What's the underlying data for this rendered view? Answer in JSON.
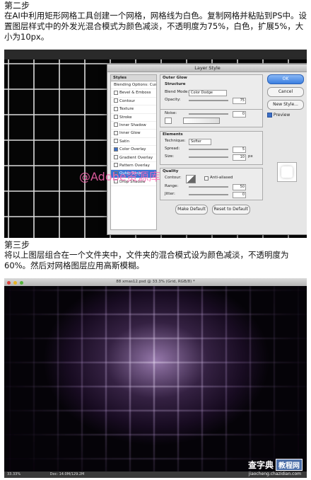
{
  "step2": {
    "title": "第二步",
    "text": "在AI中利用矩形网格工具创建一个网格，网格线为白色。复制网格并粘贴到PS中。设置图层样式中的外发光混合模式为颜色减淡，不透明度为75%，白色，扩展5%，大小为10px。"
  },
  "step3": {
    "title": "第三步",
    "text": "将以上图层组合在一个文件夹中，文件夹的混合模式设为颜色减淡，不透明度为60%。然后对网格图层应用高斯模糊。"
  },
  "dialog": {
    "title": "Layer Style",
    "styles_header": "Styles",
    "styles": [
      {
        "label": "Blending Options: Custom",
        "checked": false,
        "selected": false
      },
      {
        "label": "Bevel & Emboss",
        "checked": false,
        "selected": false
      },
      {
        "label": "Contour",
        "checked": false,
        "selected": false
      },
      {
        "label": "Texture",
        "checked": false,
        "selected": false
      },
      {
        "label": "Stroke",
        "checked": false,
        "selected": false
      },
      {
        "label": "Inner Shadow",
        "checked": false,
        "selected": false
      },
      {
        "label": "Inner Glow",
        "checked": false,
        "selected": false
      },
      {
        "label": "Satin",
        "checked": false,
        "selected": false
      },
      {
        "label": "Color Overlay",
        "checked": true,
        "selected": false
      },
      {
        "label": "Gradient Overlay",
        "checked": false,
        "selected": false
      },
      {
        "label": "Pattern Overlay",
        "checked": false,
        "selected": false
      },
      {
        "label": "Outer Glow",
        "checked": true,
        "selected": true
      },
      {
        "label": "Drop Shadow",
        "checked": false,
        "selected": false
      }
    ],
    "outer_glow": {
      "section": "Outer Glow",
      "structure": "Structure",
      "blend_mode_label": "Blend Mode:",
      "blend_mode_value": "Color Dodge",
      "opacity_label": "Opacity:",
      "opacity_value": "75",
      "noise_label": "Noise:",
      "noise_value": "0"
    },
    "elements": {
      "section": "Elements",
      "technique_label": "Technique:",
      "technique_value": "Softer",
      "spread_label": "Spread:",
      "spread_value": "5",
      "size_label": "Size:",
      "size_value": "10",
      "unit": "px"
    },
    "quality": {
      "section": "Quality",
      "contour_label": "Contour:",
      "anti_aliased": "Anti-aliased",
      "range_label": "Range:",
      "range_value": "50",
      "jitter_label": "Jitter:",
      "jitter_value": "0"
    },
    "buttons": {
      "ok": "OK",
      "cancel": "Cancel",
      "new_style": "New Style...",
      "preview": "Preview",
      "make_default": "Make Default",
      "reset_default": "Reset to Default"
    }
  },
  "watermark": "@Adobe资源库",
  "shot2": {
    "window_title": "88 xmas12.psd @ 33.3% (Grid, RGB/8) *",
    "zoom": "33.33%",
    "doc_info": "Doc: 14.0M/129.2M"
  },
  "brand": {
    "logo_text": "查字典",
    "logo_box": "教程网",
    "url": "jiaocheng.chazidian.com"
  },
  "colors": {
    "grid_line": "#dcdcdc",
    "glow": "#b48fd0",
    "selection": "#3b75d6"
  }
}
